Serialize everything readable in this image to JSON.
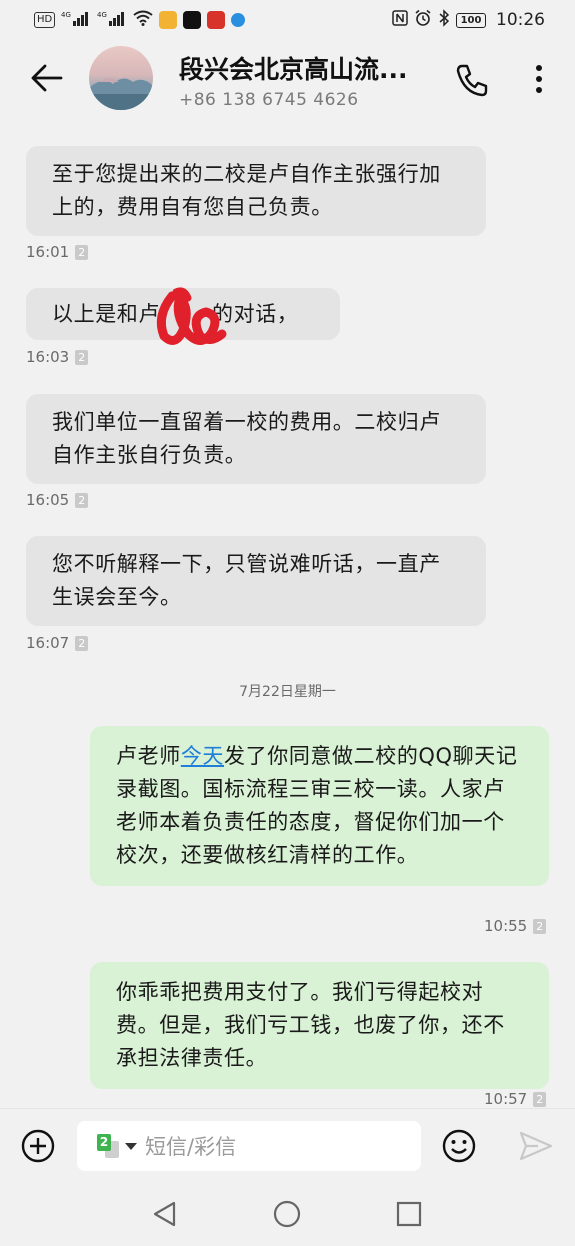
{
  "status_bar": {
    "left_chips": [
      "HD",
      "4G",
      "4G"
    ],
    "time": "10:26",
    "battery": "100"
  },
  "header": {
    "contact_name": "段兴会北京高山流...",
    "phone": "+86 138 6745 4626"
  },
  "messages": [
    {
      "dir": "in",
      "text": "至于您提出来的二校是卢自作主张强行加上的，费用自有您自己负责。",
      "time": "16:01",
      "sim": "2"
    },
    {
      "dir": "in",
      "text_before": "以上是和卢",
      "text_after": "的对话，",
      "time": "16:03",
      "sim": "2"
    },
    {
      "dir": "in",
      "text": "我们单位一直留着一校的费用。二校归卢自作主张自行负责。",
      "time": "16:05",
      "sim": "2"
    },
    {
      "dir": "in",
      "text": "您不听解释一下，只管说难听话，一直产生误会至今。",
      "time": "16:07",
      "sim": "2"
    },
    {
      "dir": "sep",
      "text": "7月22日星期一"
    },
    {
      "dir": "out",
      "text_before": "卢老师",
      "link": "今天",
      "text_after": "发了你同意做二校的QQ聊天记录截图。国标流程三审三校一读。人家卢老师本着负责任的态度，督促你们加一个校次，还要做核红清样的工作。",
      "time": "10:55",
      "sim": "2"
    },
    {
      "dir": "out",
      "text": "你乖乖把费用支付了。我们亏得起校对费。但是，我们亏工钱，也废了你，还不承担法律责任。",
      "time": "10:57",
      "sim": "2"
    }
  ],
  "input": {
    "sim_slot": "2",
    "placeholder": "短信/彩信"
  },
  "colors": {
    "incoming_bubble": "#e4e4e4",
    "outgoing_bubble": "#d9f2d5",
    "link": "#1e7ed8",
    "scribble": "#e0202a"
  }
}
